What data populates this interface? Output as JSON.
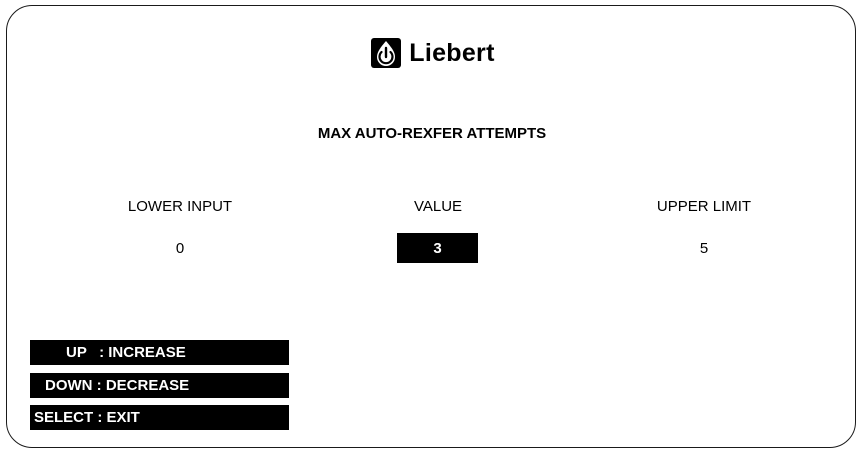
{
  "brand": {
    "name": "Liebert",
    "logo_icon": "power-drop-icon"
  },
  "screen": {
    "title": "MAX AUTO-REXFER ATTEMPTS"
  },
  "columns": {
    "lower": {
      "label": "LOWER INPUT",
      "value": "0"
    },
    "current": {
      "label": "VALUE",
      "value": "3"
    },
    "upper": {
      "label": "UPPER LIMIT",
      "value": "5"
    }
  },
  "keys": [
    {
      "label": "UP   : INCREASE"
    },
    {
      "label": "DOWN : DECREASE"
    },
    {
      "label": "SELECT : EXIT"
    }
  ],
  "colors": {
    "background": "#ffffff",
    "foreground": "#000000",
    "highlight_text": "#ffffff"
  }
}
